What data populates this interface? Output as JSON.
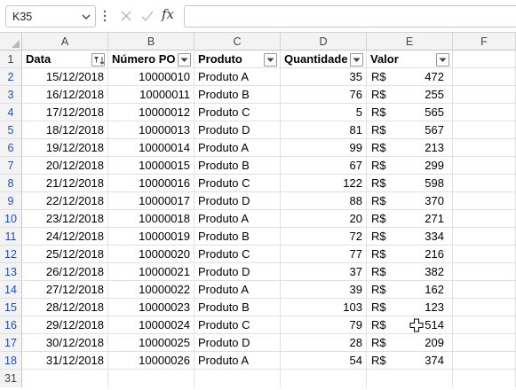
{
  "namebox": {
    "value": "K35"
  },
  "formula_bar": {
    "fx_label": "fx",
    "content": ""
  },
  "columns": [
    "A",
    "B",
    "C",
    "D",
    "E",
    "F"
  ],
  "headers": {
    "data": "Data",
    "numero_po": "Número PO",
    "produto": "Produto",
    "quantidade": "Quantidade",
    "valor": "Valor"
  },
  "header_row_number": "1",
  "rows": [
    {
      "row": "2",
      "data": "15/12/2018",
      "po": "10000010",
      "produto": "Produto A",
      "qtd": "35",
      "moeda": "R$",
      "valor": "472"
    },
    {
      "row": "3",
      "data": "16/12/2018",
      "po": "10000011",
      "produto": "Produto B",
      "qtd": "76",
      "moeda": "R$",
      "valor": "255"
    },
    {
      "row": "4",
      "data": "17/12/2018",
      "po": "10000012",
      "produto": "Produto C",
      "qtd": "5",
      "moeda": "R$",
      "valor": "565"
    },
    {
      "row": "5",
      "data": "18/12/2018",
      "po": "10000013",
      "produto": "Produto D",
      "qtd": "81",
      "moeda": "R$",
      "valor": "567"
    },
    {
      "row": "6",
      "data": "19/12/2018",
      "po": "10000014",
      "produto": "Produto A",
      "qtd": "99",
      "moeda": "R$",
      "valor": "213"
    },
    {
      "row": "7",
      "data": "20/12/2018",
      "po": "10000015",
      "produto": "Produto B",
      "qtd": "67",
      "moeda": "R$",
      "valor": "299"
    },
    {
      "row": "8",
      "data": "21/12/2018",
      "po": "10000016",
      "produto": "Produto C",
      "qtd": "122",
      "moeda": "R$",
      "valor": "598"
    },
    {
      "row": "9",
      "data": "22/12/2018",
      "po": "10000017",
      "produto": "Produto D",
      "qtd": "88",
      "moeda": "R$",
      "valor": "370"
    },
    {
      "row": "10",
      "data": "23/12/2018",
      "po": "10000018",
      "produto": "Produto A",
      "qtd": "20",
      "moeda": "R$",
      "valor": "271"
    },
    {
      "row": "11",
      "data": "24/12/2018",
      "po": "10000019",
      "produto": "Produto B",
      "qtd": "72",
      "moeda": "R$",
      "valor": "334"
    },
    {
      "row": "12",
      "data": "25/12/2018",
      "po": "10000020",
      "produto": "Produto C",
      "qtd": "77",
      "moeda": "R$",
      "valor": "216"
    },
    {
      "row": "13",
      "data": "26/12/2018",
      "po": "10000021",
      "produto": "Produto D",
      "qtd": "37",
      "moeda": "R$",
      "valor": "382"
    },
    {
      "row": "14",
      "data": "27/12/2018",
      "po": "10000022",
      "produto": "Produto A",
      "qtd": "39",
      "moeda": "R$",
      "valor": "162"
    },
    {
      "row": "15",
      "data": "28/12/2018",
      "po": "10000023",
      "produto": "Produto B",
      "qtd": "103",
      "moeda": "R$",
      "valor": "123"
    },
    {
      "row": "16",
      "data": "29/12/2018",
      "po": "10000024",
      "produto": "Produto C",
      "qtd": "79",
      "moeda": "R$",
      "valor": "514"
    },
    {
      "row": "17",
      "data": "30/12/2018",
      "po": "10000025",
      "produto": "Produto D",
      "qtd": "28",
      "moeda": "R$",
      "valor": "209"
    },
    {
      "row": "18",
      "data": "31/12/2018",
      "po": "10000026",
      "produto": "Produto A",
      "qtd": "54",
      "moeda": "R$",
      "valor": "374"
    }
  ],
  "trailing_row_number": "31",
  "icons": {
    "chevron": "chevron-down-icon",
    "cancel": "x-icon",
    "enter": "check-icon",
    "filter": "filter-dropdown-icon",
    "active_filter": "filter-active-icon",
    "cursor": "cell-select-cursor-icon"
  },
  "colors": {
    "filtered_row_number": "#1f4ec2",
    "header_bg": "#f3f3f3",
    "gridline": "#e1e1e1"
  }
}
